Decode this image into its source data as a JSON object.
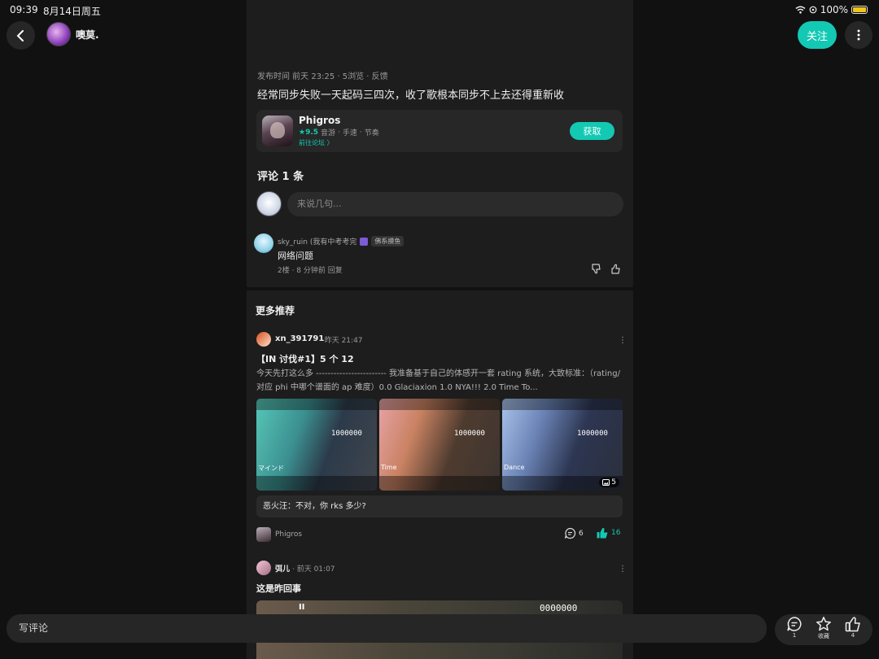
{
  "status": {
    "time": "09:39",
    "date": "8月14日周五",
    "battery": "100%",
    "battery_level": 1.0
  },
  "header": {
    "author": "噢莫.",
    "follow": "关注"
  },
  "post": {
    "meta": "发布时间 前天 23:25 · 5浏览 · 反馈",
    "body": "经常同步失败一天起码三四次，收了歌根本同步不上去还得重新收"
  },
  "app": {
    "name": "Phigros",
    "rating": "★9.5",
    "tags": [
      "音游",
      "·",
      "手速",
      "·",
      "节奏"
    ],
    "forum": "前往论坛 〉",
    "get": "获取"
  },
  "comments": {
    "title": "评论 1 条",
    "placeholder": "来说几句...",
    "items": [
      {
        "user": "sky_ruin (我有中考考完",
        "badge": "佛系摸鱼",
        "text": "网络问题",
        "meta": "2楼 · 8 分钟前  回复"
      }
    ]
  },
  "recommend": {
    "title": "更多推荐",
    "post1": {
      "user": "xn_391791",
      "time": "· 昨天 21:47",
      "title": "【IN 讨伐#1】5 个 12",
      "body": "今天先打这么多 ------------------------ 我准备基于自己的体感开一套 rating 系统，大致标准：（rating/对应 phi 中哪个谱面的 ap 难度）0.0 Glaciaxion  1.0 NYA!!!  2.0 Time To...",
      "thumbs": [
        {
          "score": "1000000",
          "label": "マインド"
        },
        {
          "score": "1000000",
          "label": "Time"
        },
        {
          "score": "1000000",
          "label": "Dance"
        }
      ],
      "image_count": "5",
      "hot_comment": "恶火汪：不对，你 rks 多少?",
      "game": "Phigros",
      "comment_count": "6",
      "like_count": "16"
    },
    "post2": {
      "user": "弭儿",
      "time": "· 前天 01:07",
      "title": "这是昨回事",
      "pause": "II",
      "score": "0000000"
    }
  },
  "bottom": {
    "placeholder": "写评论",
    "comment_count": "1",
    "favorite": "收藏",
    "like_count": "4"
  },
  "colors": {
    "accent": "#13c9b3",
    "panel": "#1d1d1d",
    "background": "#111111"
  }
}
